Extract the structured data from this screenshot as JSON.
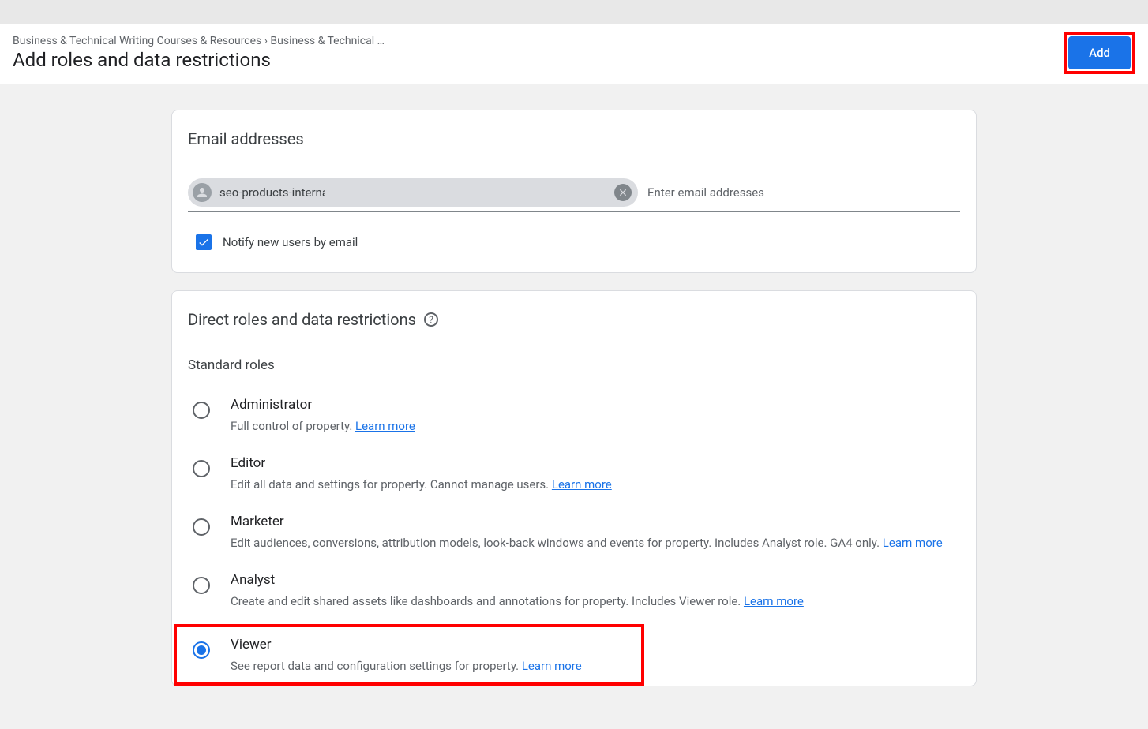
{
  "breadcrumb": "Business & Technical Writing Courses & Resources › Business & Technical …",
  "page_title": "Add roles and data restrictions",
  "add_button": "Add",
  "email_section": {
    "heading": "Email addresses",
    "chip_text": "seo-products-interna",
    "placeholder": "Enter email addresses",
    "notify_label": "Notify new users by email"
  },
  "roles_section": {
    "heading": "Direct roles and data restrictions",
    "sub_heading": "Standard roles",
    "learn_more": "Learn more",
    "roles": [
      {
        "title": "Administrator",
        "desc": "Full control of property. ",
        "selected": false
      },
      {
        "title": "Editor",
        "desc": "Edit all data and settings for property. Cannot manage users. ",
        "selected": false
      },
      {
        "title": "Marketer",
        "desc": "Edit audiences, conversions, attribution models, look-back windows and events for property. Includes Analyst role. GA4 only. ",
        "selected": false
      },
      {
        "title": "Analyst",
        "desc": "Create and edit shared assets like dashboards and annotations for property. Includes Viewer role. ",
        "selected": false
      },
      {
        "title": "Viewer",
        "desc": "See report data and configuration settings for property. ",
        "selected": true
      }
    ]
  }
}
